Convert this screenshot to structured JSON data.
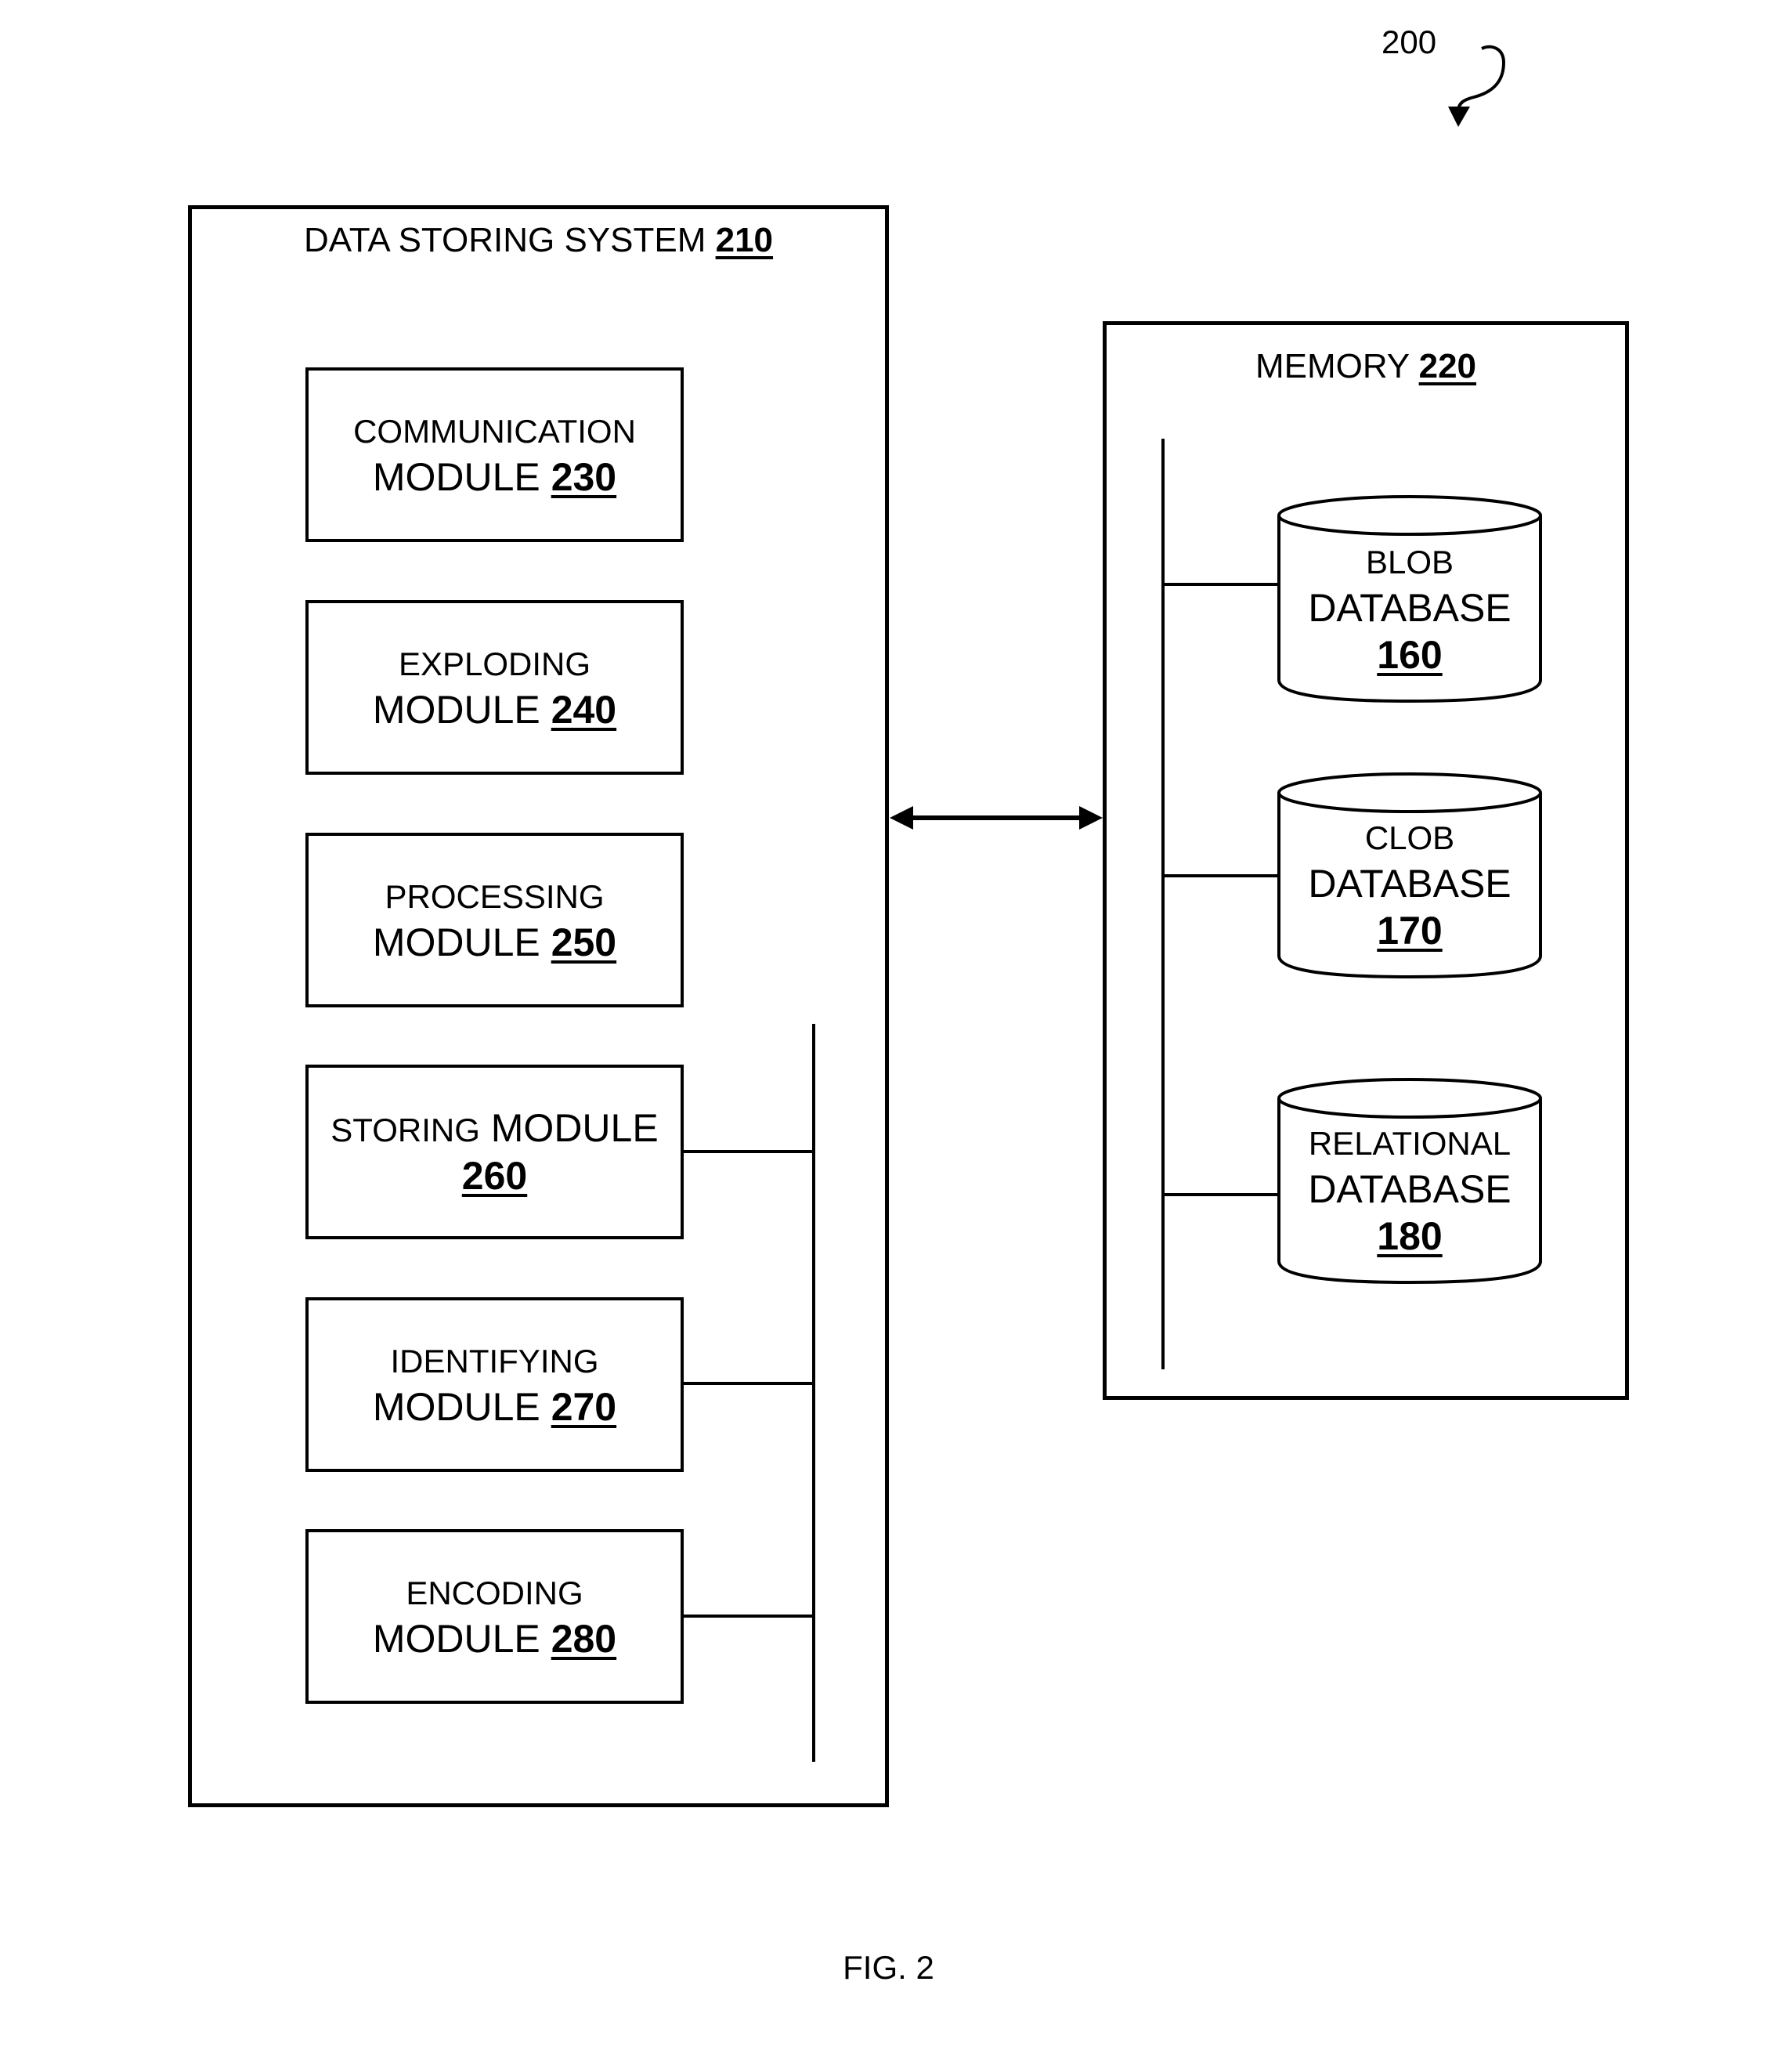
{
  "figure": {
    "reference_label": "200",
    "caption": "FIG. 2"
  },
  "data_storing_system": {
    "title": "DATA STORING SYSTEM",
    "number": "210",
    "modules": [
      {
        "line1": "COMMUNICATION",
        "line2": "MODULE",
        "number": "230"
      },
      {
        "line1": "EXPLODING",
        "line2": "MODULE",
        "number": "240"
      },
      {
        "line1": "PROCESSING",
        "line2": "MODULE",
        "number": "250"
      },
      {
        "line1": "STORING",
        "line2": "MODULE",
        "number": "260"
      },
      {
        "line1": "IDENTIFYING",
        "line2": "MODULE",
        "number": "270"
      },
      {
        "line1": "ENCODING",
        "line2": "MODULE",
        "number": "280"
      }
    ]
  },
  "memory": {
    "title": "MEMORY",
    "number": "220",
    "databases": [
      {
        "line1": "BLOB",
        "line2": "DATABASE",
        "number": "160"
      },
      {
        "line1": "CLOB",
        "line2": "DATABASE",
        "number": "170"
      },
      {
        "line1": "RELATIONAL",
        "line2": "DATABASE",
        "number": "180"
      }
    ]
  },
  "connection": {
    "type": "bidirectional-arrow",
    "from": "DATA STORING SYSTEM 210",
    "to": "MEMORY 220"
  }
}
